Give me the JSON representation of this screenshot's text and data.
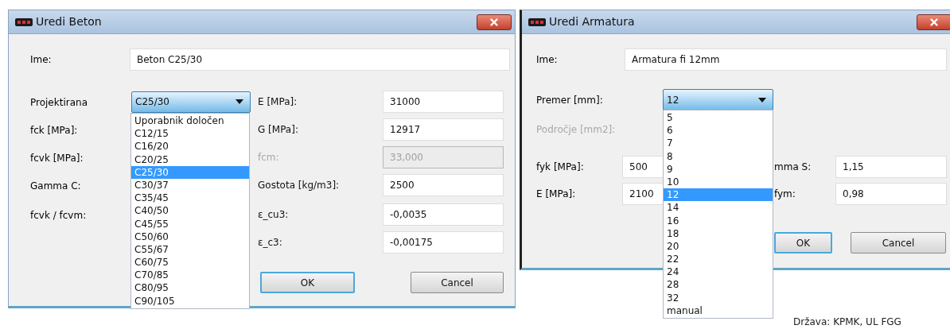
{
  "dialogs": [
    {
      "title": "Uredi Beton",
      "name": {
        "label": "Ime:",
        "value": "Beton C25/30"
      },
      "grade": {
        "label": "Projektirana",
        "value": "C25/30",
        "options": [
          {
            "label": "Uporabnik določen",
            "selected": false
          },
          {
            "label": "C12/15",
            "selected": false
          },
          {
            "label": "C16/20",
            "selected": false
          },
          {
            "label": "C20/25",
            "selected": false
          },
          {
            "label": "C25/30",
            "selected": true
          },
          {
            "label": "C30/37",
            "selected": false
          },
          {
            "label": "C35/45",
            "selected": false
          },
          {
            "label": "C40/50",
            "selected": false
          },
          {
            "label": "C45/55",
            "selected": false
          },
          {
            "label": "C50/60",
            "selected": false
          },
          {
            "label": "C55/67",
            "selected": false
          },
          {
            "label": "C60/75",
            "selected": false
          },
          {
            "label": "C70/85",
            "selected": false
          },
          {
            "label": "C80/95",
            "selected": false
          },
          {
            "label": "C90/105",
            "selected": false
          }
        ]
      },
      "left_labels": [
        "fck [MPa]:",
        "fcvk [MPa]:",
        "Gamma C:",
        "fcvk / fcvm:"
      ],
      "right_fields": [
        {
          "label": "E [MPa]:",
          "value": "31000",
          "disabled": false
        },
        {
          "label": "G [MPa]:",
          "value": "12917",
          "disabled": false
        },
        {
          "label": "fcm:",
          "value": "33,000",
          "disabled": true
        },
        {
          "label": "Gostota [kg/m3]:",
          "value": "2500",
          "disabled": false
        },
        {
          "label": "ε_cu3:",
          "value": "-0,0035",
          "disabled": false
        },
        {
          "label": "ε_c3:",
          "value": "-0,00175",
          "disabled": false
        }
      ],
      "buttons": [
        {
          "label": "OK",
          "default": true
        },
        {
          "label": "Cancel",
          "default": false
        }
      ]
    },
    {
      "title": "Uredi Armatura",
      "name": {
        "label": "Ime:",
        "value": "Armatura fi 12mm"
      },
      "diameter": {
        "label": "Premer [mm]:",
        "value": "12",
        "options": [
          {
            "label": "5",
            "selected": false
          },
          {
            "label": "6",
            "selected": false
          },
          {
            "label": "7",
            "selected": false
          },
          {
            "label": "8",
            "selected": false
          },
          {
            "label": "9",
            "selected": false
          },
          {
            "label": "10",
            "selected": false
          },
          {
            "label": "12",
            "selected": true
          },
          {
            "label": "14",
            "selected": false
          },
          {
            "label": "16",
            "selected": false
          },
          {
            "label": "18",
            "selected": false
          },
          {
            "label": "20",
            "selected": false
          },
          {
            "label": "22",
            "selected": false
          },
          {
            "label": "24",
            "selected": false
          },
          {
            "label": "28",
            "selected": false
          },
          {
            "label": "32",
            "selected": false
          },
          {
            "label": "manual",
            "selected": false
          }
        ]
      },
      "area": {
        "label": "Področje [mm2]:",
        "disabled": true
      },
      "rows": [
        {
          "label": "fyk [MPa]:",
          "value": "500",
          "label_2": "mma S:",
          "value_2": "1,15"
        },
        {
          "label": "E [MPa]:",
          "value": "2100",
          "label_2": "fym:",
          "value_2": "0,98"
        }
      ],
      "buttons": [
        {
          "label": "OK",
          "default": true
        },
        {
          "label": "Cancel",
          "default": false
        }
      ]
    }
  ],
  "status": "Država: KPMK, UL FGG"
}
